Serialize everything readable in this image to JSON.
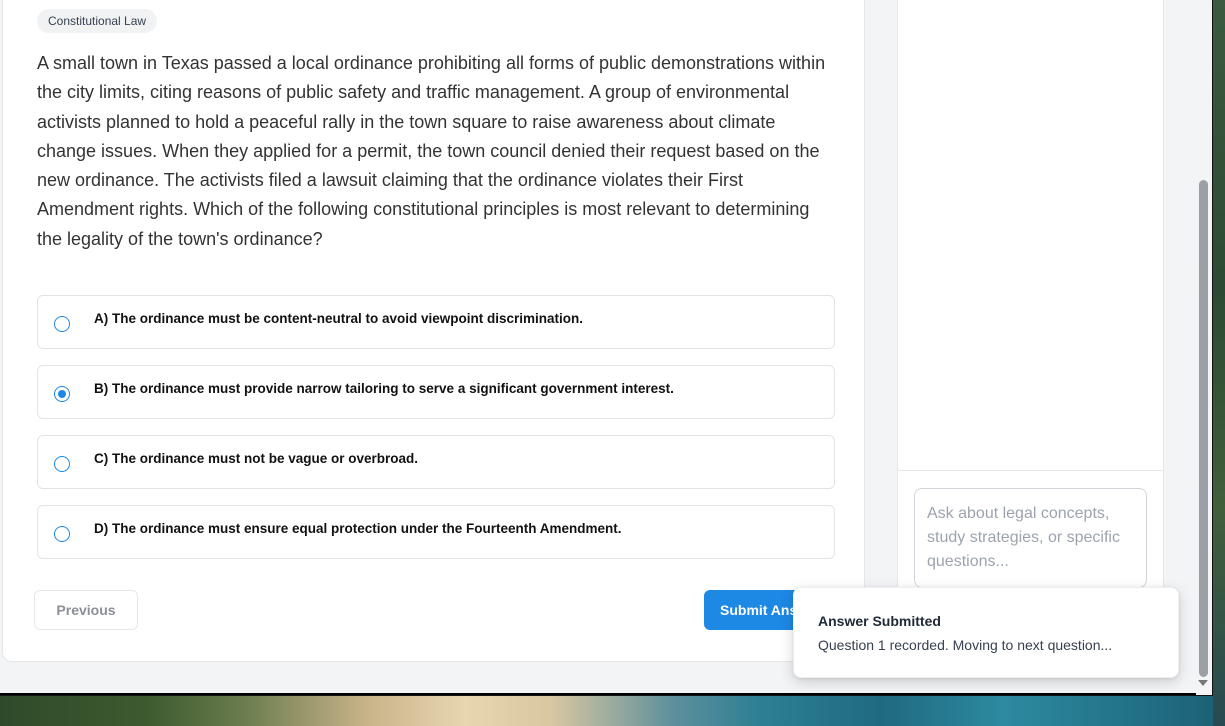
{
  "question": {
    "category": "Constitutional Law",
    "text": "A small town in Texas passed a local ordinance prohibiting all forms of public demonstrations within the city limits, citing reasons of public safety and traffic management. A group of environmental activists planned to hold a peaceful rally in the town square to raise awareness about climate change issues. When they applied for a permit, the town council denied their request based on the new ordinance. The activists filed a lawsuit claiming that the ordinance violates their First Amendment rights. Which of the following constitutional principles is most relevant to determining the legality of the town's ordinance?",
    "options": [
      {
        "label": "A) The ordinance must be content-neutral to avoid viewpoint discrimination.",
        "selected": false
      },
      {
        "label": "B) The ordinance must provide narrow tailoring to serve a significant government interest.",
        "selected": true
      },
      {
        "label": "C) The ordinance must not be vague or overbroad.",
        "selected": false
      },
      {
        "label": "D) The ordinance must ensure equal protection under the Fourteenth Amendment.",
        "selected": false
      }
    ]
  },
  "navigation": {
    "previous_label": "Previous",
    "submit_label": "Submit Answer"
  },
  "chat": {
    "input_placeholder": "Ask about legal concepts, study strategies, or specific questions..."
  },
  "toast": {
    "title": "Answer Submitted",
    "message": "Question 1 recorded. Moving to next question..."
  },
  "colors": {
    "accent": "#1e88e5",
    "page_background": "#f3f4f6"
  }
}
